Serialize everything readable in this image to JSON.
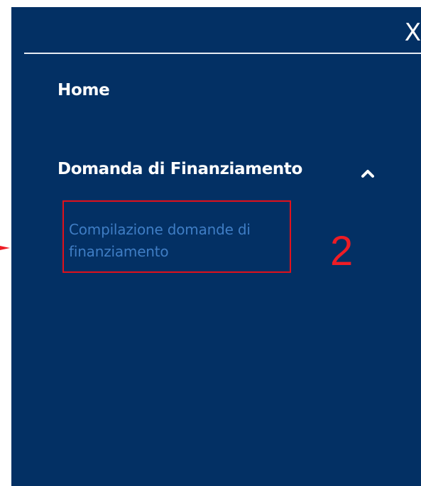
{
  "menu": {
    "close_label": "X",
    "items": [
      {
        "label": "Home"
      },
      {
        "label": "Domanda di Finanziamento",
        "expanded": true,
        "chevron_icon": "chevron-up-icon"
      }
    ],
    "subitems": [
      {
        "label": "Compilazione domande di finanziamento",
        "highlighted": true
      }
    ]
  },
  "annotation": {
    "step_number": "2",
    "color": "#ee1c25"
  },
  "colors": {
    "panel_bg": "#033064",
    "menu_text": "#ffffff",
    "subitem_text": "#3f7dc4",
    "highlight_border": "#e0111b"
  }
}
